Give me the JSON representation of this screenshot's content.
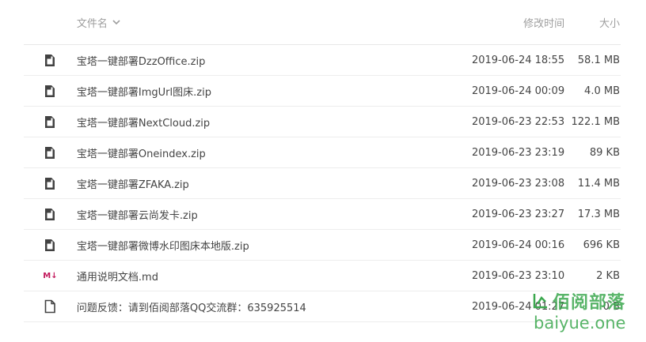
{
  "header": {
    "name": "文件名",
    "date": "修改时间",
    "size": "大小"
  },
  "rows": [
    {
      "name": "宝塔一键部署DzzOffice.zip",
      "date": "2019-06-24 18:55",
      "size": "58.1 MB",
      "icon": "file-icon"
    },
    {
      "name": "宝塔一键部署ImgUrl图床.zip",
      "date": "2019-06-24 00:09",
      "size": "4.0 MB",
      "icon": "file-icon"
    },
    {
      "name": "宝塔一键部署NextCloud.zip",
      "date": "2019-06-23 22:53",
      "size": "122.1 MB",
      "icon": "file-icon"
    },
    {
      "name": "宝塔一键部署Oneindex.zip",
      "date": "2019-06-23 23:19",
      "size": "89 KB",
      "icon": "file-icon"
    },
    {
      "name": "宝塔一键部署ZFAKA.zip",
      "date": "2019-06-23 23:08",
      "size": "11.4 MB",
      "icon": "file-icon"
    },
    {
      "name": "宝塔一键部署云尚发卡.zip",
      "date": "2019-06-23 23:27",
      "size": "17.3 MB",
      "icon": "file-icon"
    },
    {
      "name": "宝塔一键部署微博水印图床本地版.zip",
      "date": "2019-06-24 00:16",
      "size": "696 KB",
      "icon": "file-icon"
    },
    {
      "name": "通用说明文档.md",
      "date": "2019-06-23 23:10",
      "size": "2 KB",
      "icon": "markdown-icon"
    },
    {
      "name": "问题反馈：请到佰阅部落QQ交流群：635925514",
      "date": "2019-06-24 01:27",
      "size": "0 B",
      "icon": "file-outline-icon"
    }
  ],
  "watermark": {
    "name": "佰阅部落",
    "url": "baiyue.one"
  },
  "colors": {
    "accent": "#3ba84e",
    "markdown": "#c2185b",
    "header_text": "#9e9e9e"
  }
}
